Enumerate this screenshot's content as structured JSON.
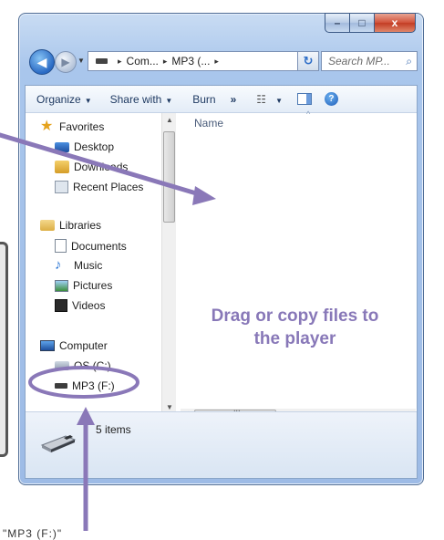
{
  "window": {
    "caption": {
      "minimize": "–",
      "maximize": "□",
      "close": "x"
    }
  },
  "nav": {
    "back_glyph": "◀",
    "forward_glyph": "▶",
    "history_glyph": "▼"
  },
  "address": {
    "crumbs": [
      "Com...",
      "MP3 (..."
    ],
    "separator": "▸",
    "dropdown_glyph": "▼",
    "refresh_glyph": "↻"
  },
  "search": {
    "placeholder": "Search MP...",
    "icon_glyph": "⌕"
  },
  "toolbar": {
    "organize": "Organize",
    "share_with": "Share with",
    "burn": "Burn",
    "more": "»",
    "view_glyph": "☷",
    "help_glyph": "?"
  },
  "navpane": {
    "favorites": "Favorites",
    "desktop": "Desktop",
    "downloads": "Downloads",
    "recent_places": "Recent Places",
    "libraries": "Libraries",
    "documents": "Documents",
    "music": "Music",
    "pictures": "Pictures",
    "videos": "Videos",
    "computer": "Computer",
    "os_drive": "OS (C:)",
    "mp3_drive": "MP3 (F:)"
  },
  "content": {
    "column_name": "Name",
    "sort_caret": "^",
    "drop_hint_line1": "Drag or copy files to",
    "drop_hint_line2": "the player",
    "hscroll_grip": "III"
  },
  "details": {
    "item_count": "5 items"
  },
  "annotation": {
    "bottom_label": "\"MP3 (F:)\"",
    "accent_color": "#8a78b8"
  }
}
